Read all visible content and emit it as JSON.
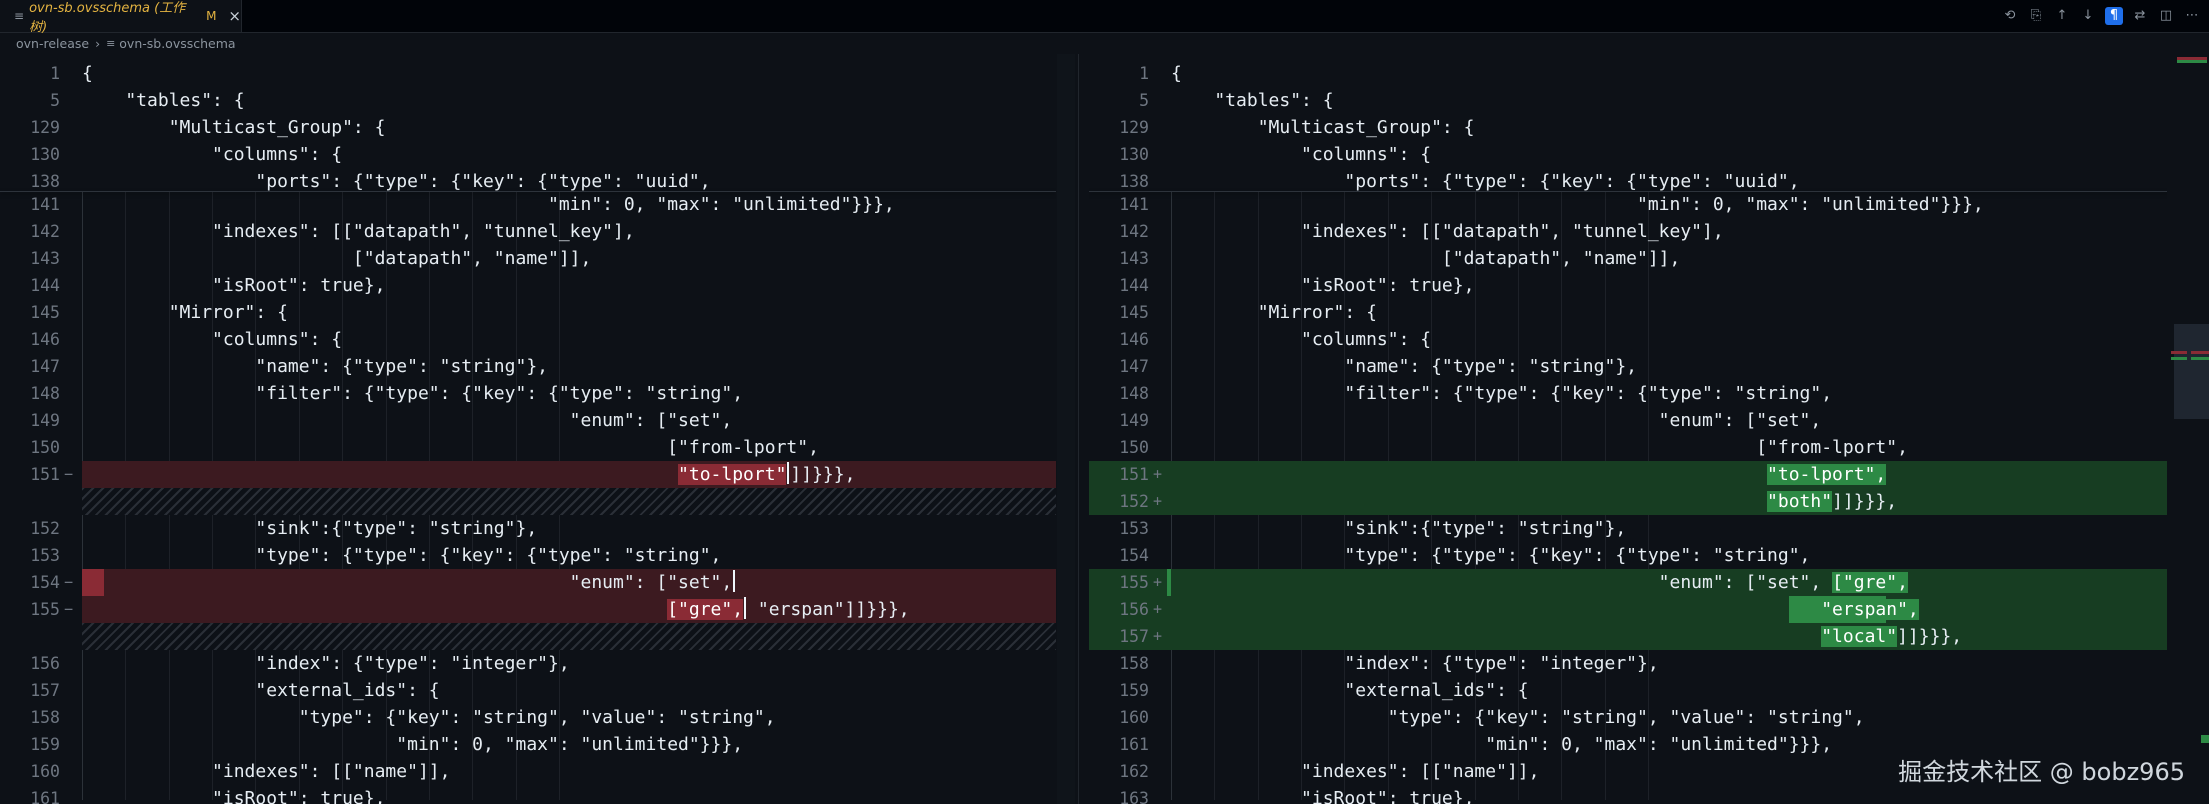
{
  "tab": {
    "title": "ovn-sb.ovsschema (工作树)",
    "modified": "M",
    "close": "×",
    "file_icon": "file-lines-icon"
  },
  "breadcrumbs": [
    "ovn-release",
    "ovn-sb.ovsschema"
  ],
  "actions": [
    {
      "name": "timeline-icon",
      "glyph": "⟲"
    },
    {
      "name": "open-file-icon",
      "glyph": "⎘"
    },
    {
      "name": "arrow-up-icon",
      "glyph": "↑"
    },
    {
      "name": "arrow-down-icon",
      "glyph": "↓"
    },
    {
      "name": "whitespace-icon",
      "glyph": "¶"
    },
    {
      "name": "compare-icon",
      "glyph": "⇄"
    },
    {
      "name": "split-editor-icon",
      "glyph": "◫"
    },
    {
      "name": "more-icon",
      "glyph": "⋯"
    }
  ],
  "colors": {
    "background": "#0d1117",
    "deleted_line": "#3c1a20",
    "deleted_highlight": "#8a2b35",
    "inserted_line": "#173d22",
    "inserted_highlight": "#2d8a45"
  },
  "left_lines": [
    {
      "num": "1",
      "code": "{"
    },
    {
      "num": "5",
      "code": "    \"tables\": {"
    },
    {
      "num": "129",
      "code": "        \"Multicast_Group\": {"
    },
    {
      "num": "130",
      "code": "            \"columns\": {"
    },
    {
      "num": "138",
      "code": "                \"ports\": {\"type\": {\"key\": {\"type\": \"uuid\","
    },
    {
      "num": "141",
      "code": "                                           \"min\": 0, \"max\": \"unlimited\"}}},"
    },
    {
      "num": "142",
      "code": "            \"indexes\": [[\"datapath\", \"tunnel_key\"],"
    },
    {
      "num": "143",
      "code": "                         [\"datapath\", \"name\"]],"
    },
    {
      "num": "144",
      "code": "            \"isRoot\": true},"
    },
    {
      "num": "145",
      "code": "        \"Mirror\": {"
    },
    {
      "num": "146",
      "code": "            \"columns\": {"
    },
    {
      "num": "147",
      "code": "                \"name\": {\"type\": \"string\"},"
    },
    {
      "num": "148",
      "code": "                \"filter\": {\"type\": {\"key\": {\"type\": \"string\","
    },
    {
      "num": "149",
      "code": "                                             \"enum\": [\"set\","
    },
    {
      "num": "150",
      "code": "                                                      [\"from-lport\","
    },
    {
      "num": "151",
      "mark": "−",
      "kind": "del",
      "pre": "                                                       ",
      "hl": "\"to-lport\"",
      "post": "]]}}},"
    },
    {
      "kind": "hatch"
    },
    {
      "num": "152",
      "code": "                \"sink\":{\"type\": \"string\"},"
    },
    {
      "num": "153",
      "code": "                \"type\": {\"type\": {\"key\": {\"type\": \"string\","
    },
    {
      "num": "154",
      "mark": "−",
      "kind": "del",
      "stub": true,
      "pre": "                                             \"enum\": [\"set\",",
      "hl": "",
      "post": ""
    },
    {
      "num": "155",
      "mark": "−",
      "kind": "del",
      "pre": "                                                      ",
      "hl": "[\"gre\",",
      "post": " \"erspan\"]]}}},"
    },
    {
      "kind": "hatch"
    },
    {
      "num": "156",
      "code": "                \"index\": {\"type\": \"integer\"},"
    },
    {
      "num": "157",
      "code": "                \"external_ids\": {"
    },
    {
      "num": "158",
      "code": "                    \"type\": {\"key\": \"string\", \"value\": \"string\","
    },
    {
      "num": "159",
      "code": "                             \"min\": 0, \"max\": \"unlimited\"}}},"
    },
    {
      "num": "160",
      "code": "            \"indexes\": [[\"name\"]],"
    },
    {
      "num": "161",
      "code": "            \"isRoot\": true},"
    }
  ],
  "right_lines": [
    {
      "num": "1",
      "code": "{"
    },
    {
      "num": "5",
      "code": "    \"tables\": {"
    },
    {
      "num": "129",
      "code": "        \"Multicast_Group\": {"
    },
    {
      "num": "130",
      "code": "            \"columns\": {"
    },
    {
      "num": "138",
      "code": "                \"ports\": {\"type\": {\"key\": {\"type\": \"uuid\","
    },
    {
      "num": "141",
      "code": "                                           \"min\": 0, \"max\": \"unlimited\"}}},"
    },
    {
      "num": "142",
      "code": "            \"indexes\": [[\"datapath\", \"tunnel_key\"],"
    },
    {
      "num": "143",
      "code": "                         [\"datapath\", \"name\"]],"
    },
    {
      "num": "144",
      "code": "            \"isRoot\": true},"
    },
    {
      "num": "145",
      "code": "        \"Mirror\": {"
    },
    {
      "num": "146",
      "code": "            \"columns\": {"
    },
    {
      "num": "147",
      "code": "                \"name\": {\"type\": \"string\"},"
    },
    {
      "num": "148",
      "code": "                \"filter\": {\"type\": {\"key\": {\"type\": \"string\","
    },
    {
      "num": "149",
      "code": "                                             \"enum\": [\"set\","
    },
    {
      "num": "150",
      "code": "                                                      [\"from-lport\","
    },
    {
      "num": "151",
      "mark": "+",
      "kind": "ins",
      "pre": "                                                       ",
      "hl": "\"to-lport\",",
      "post": ""
    },
    {
      "num": "152",
      "mark": "+",
      "kind": "ins",
      "pre": "                                                       ",
      "hl": "\"both\"",
      "post": "]]}}},"
    },
    {
      "num": "153",
      "code": "                \"sink\":{\"type\": \"string\"},"
    },
    {
      "num": "154",
      "code": "                \"type\": {\"type\": {\"key\": {\"type\": \"string\","
    },
    {
      "num": "155",
      "mark": "+",
      "kind": "ins",
      "stub": true,
      "pre": "                                             \"enum\": [\"set\", ",
      "hl": "[\"gre\",",
      "post": ""
    },
    {
      "num": "156",
      "mark": "+",
      "kind": "ins",
      "shade": true,
      "pre": "                                                            ",
      "hl": "\"erspan\",",
      "post": ""
    },
    {
      "num": "157",
      "mark": "+",
      "kind": "ins",
      "pre": "                                                            ",
      "hl": "\"local\"",
      "post": "]]}}},"
    },
    {
      "num": "158",
      "code": "                \"index\": {\"type\": \"integer\"},"
    },
    {
      "num": "159",
      "code": "                \"external_ids\": {"
    },
    {
      "num": "160",
      "code": "                    \"type\": {\"key\": \"string\", \"value\": \"string\","
    },
    {
      "num": "161",
      "code": "                             \"min\": 0, \"max\": \"unlimited\"}}},"
    },
    {
      "num": "162",
      "code": "            \"indexes\": [[\"name\"]],"
    },
    {
      "num": "163",
      "code": "            \"isRoot\": true},"
    }
  ],
  "watermark": "掘金技术社区 @ bobz965"
}
